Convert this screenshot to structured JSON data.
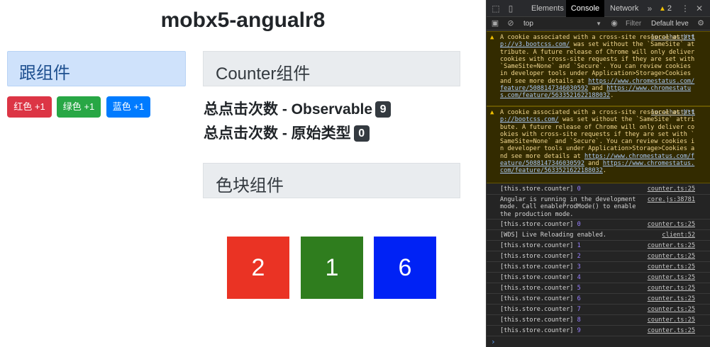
{
  "app": {
    "title": "mobx5-angualr8",
    "follow_panel": {
      "title": "跟组件",
      "buttons": {
        "red": "红色 +1",
        "green": "绿色 +1",
        "blue": "蓝色 +1"
      }
    },
    "counter_panel": {
      "title": "Counter组件",
      "observable_label": "总点击次数 - Observable",
      "observable_value": "9",
      "primitive_label": "总点击次数 - 原始类型",
      "primitive_value": "0"
    },
    "color_panel": {
      "title": "色块组件",
      "blocks": [
        {
          "value": "2",
          "color": "#ea3324"
        },
        {
          "value": "1",
          "color": "#2f7d1e"
        },
        {
          "value": "6",
          "color": "#0022f5"
        }
      ]
    }
  },
  "devtools": {
    "tabs": {
      "elements": "Elements",
      "console": "Console",
      "network": "Network"
    },
    "more_tabs": "»",
    "warning_count": "2",
    "toolbar": {
      "context": "top",
      "filter_placeholder": "Filter",
      "levels": "Default leve"
    },
    "warnings": [
      {
        "source": "localhost/:1",
        "text_before_link": "A cookie associated with a cross-site resource at ",
        "link1": "http://v3.bootcss.com/",
        "text_mid": " was set without the `SameSite` attribute. A future release of Chrome will only deliver cookies with cross-site requests if they are set with `SameSite=None` and `Secure`. You can review cookies in developer tools under Application>Storage>Cookies and see more details at ",
        "link2": "https://www.chromestatus.com/feature/5088147346030592",
        "text_and": " and ",
        "link3": "https://www.chromestatus.com/feature/5633521622188032",
        "text_end": "."
      },
      {
        "source": "localhost/:1",
        "text_before_link": "A cookie associated with a cross-site resource at ",
        "link1": "http://bootcss.com/",
        "text_mid": " was set without the `SameSite` attribute. A future release of Chrome will only deliver cookies with cross-site requests if they are set with `SameSite=None` and `Secure`. You can review cookies in developer tools under Application>Storage>Cookies and see more details at ",
        "link2": "https://www.chromestatus.com/feature/5088147346030592",
        "text_and": " and ",
        "link3": "https://www.chromestatus.com/feature/5633521622188032",
        "text_end": "."
      }
    ],
    "logs": [
      {
        "text": "[this.store.counter] ",
        "num": "0",
        "source": "counter.ts:25"
      },
      {
        "text": "Angular is running in the development mode. Call enableProdMode() to enable the production mode.",
        "num": "",
        "source": "core.js:38781"
      },
      {
        "text": "[this.store.counter] ",
        "num": "0",
        "source": "counter.ts:25"
      },
      {
        "text": "[WDS] Live Reloading enabled.",
        "num": "",
        "source": "client:52"
      },
      {
        "text": "[this.store.counter] ",
        "num": "1",
        "source": "counter.ts:25"
      },
      {
        "text": "[this.store.counter] ",
        "num": "2",
        "source": "counter.ts:25"
      },
      {
        "text": "[this.store.counter] ",
        "num": "3",
        "source": "counter.ts:25"
      },
      {
        "text": "[this.store.counter] ",
        "num": "4",
        "source": "counter.ts:25"
      },
      {
        "text": "[this.store.counter] ",
        "num": "5",
        "source": "counter.ts:25"
      },
      {
        "text": "[this.store.counter] ",
        "num": "6",
        "source": "counter.ts:25"
      },
      {
        "text": "[this.store.counter] ",
        "num": "7",
        "source": "counter.ts:25"
      },
      {
        "text": "[this.store.counter] ",
        "num": "8",
        "source": "counter.ts:25"
      },
      {
        "text": "[this.store.counter] ",
        "num": "9",
        "source": "counter.ts:25"
      }
    ],
    "prompt": "›"
  }
}
